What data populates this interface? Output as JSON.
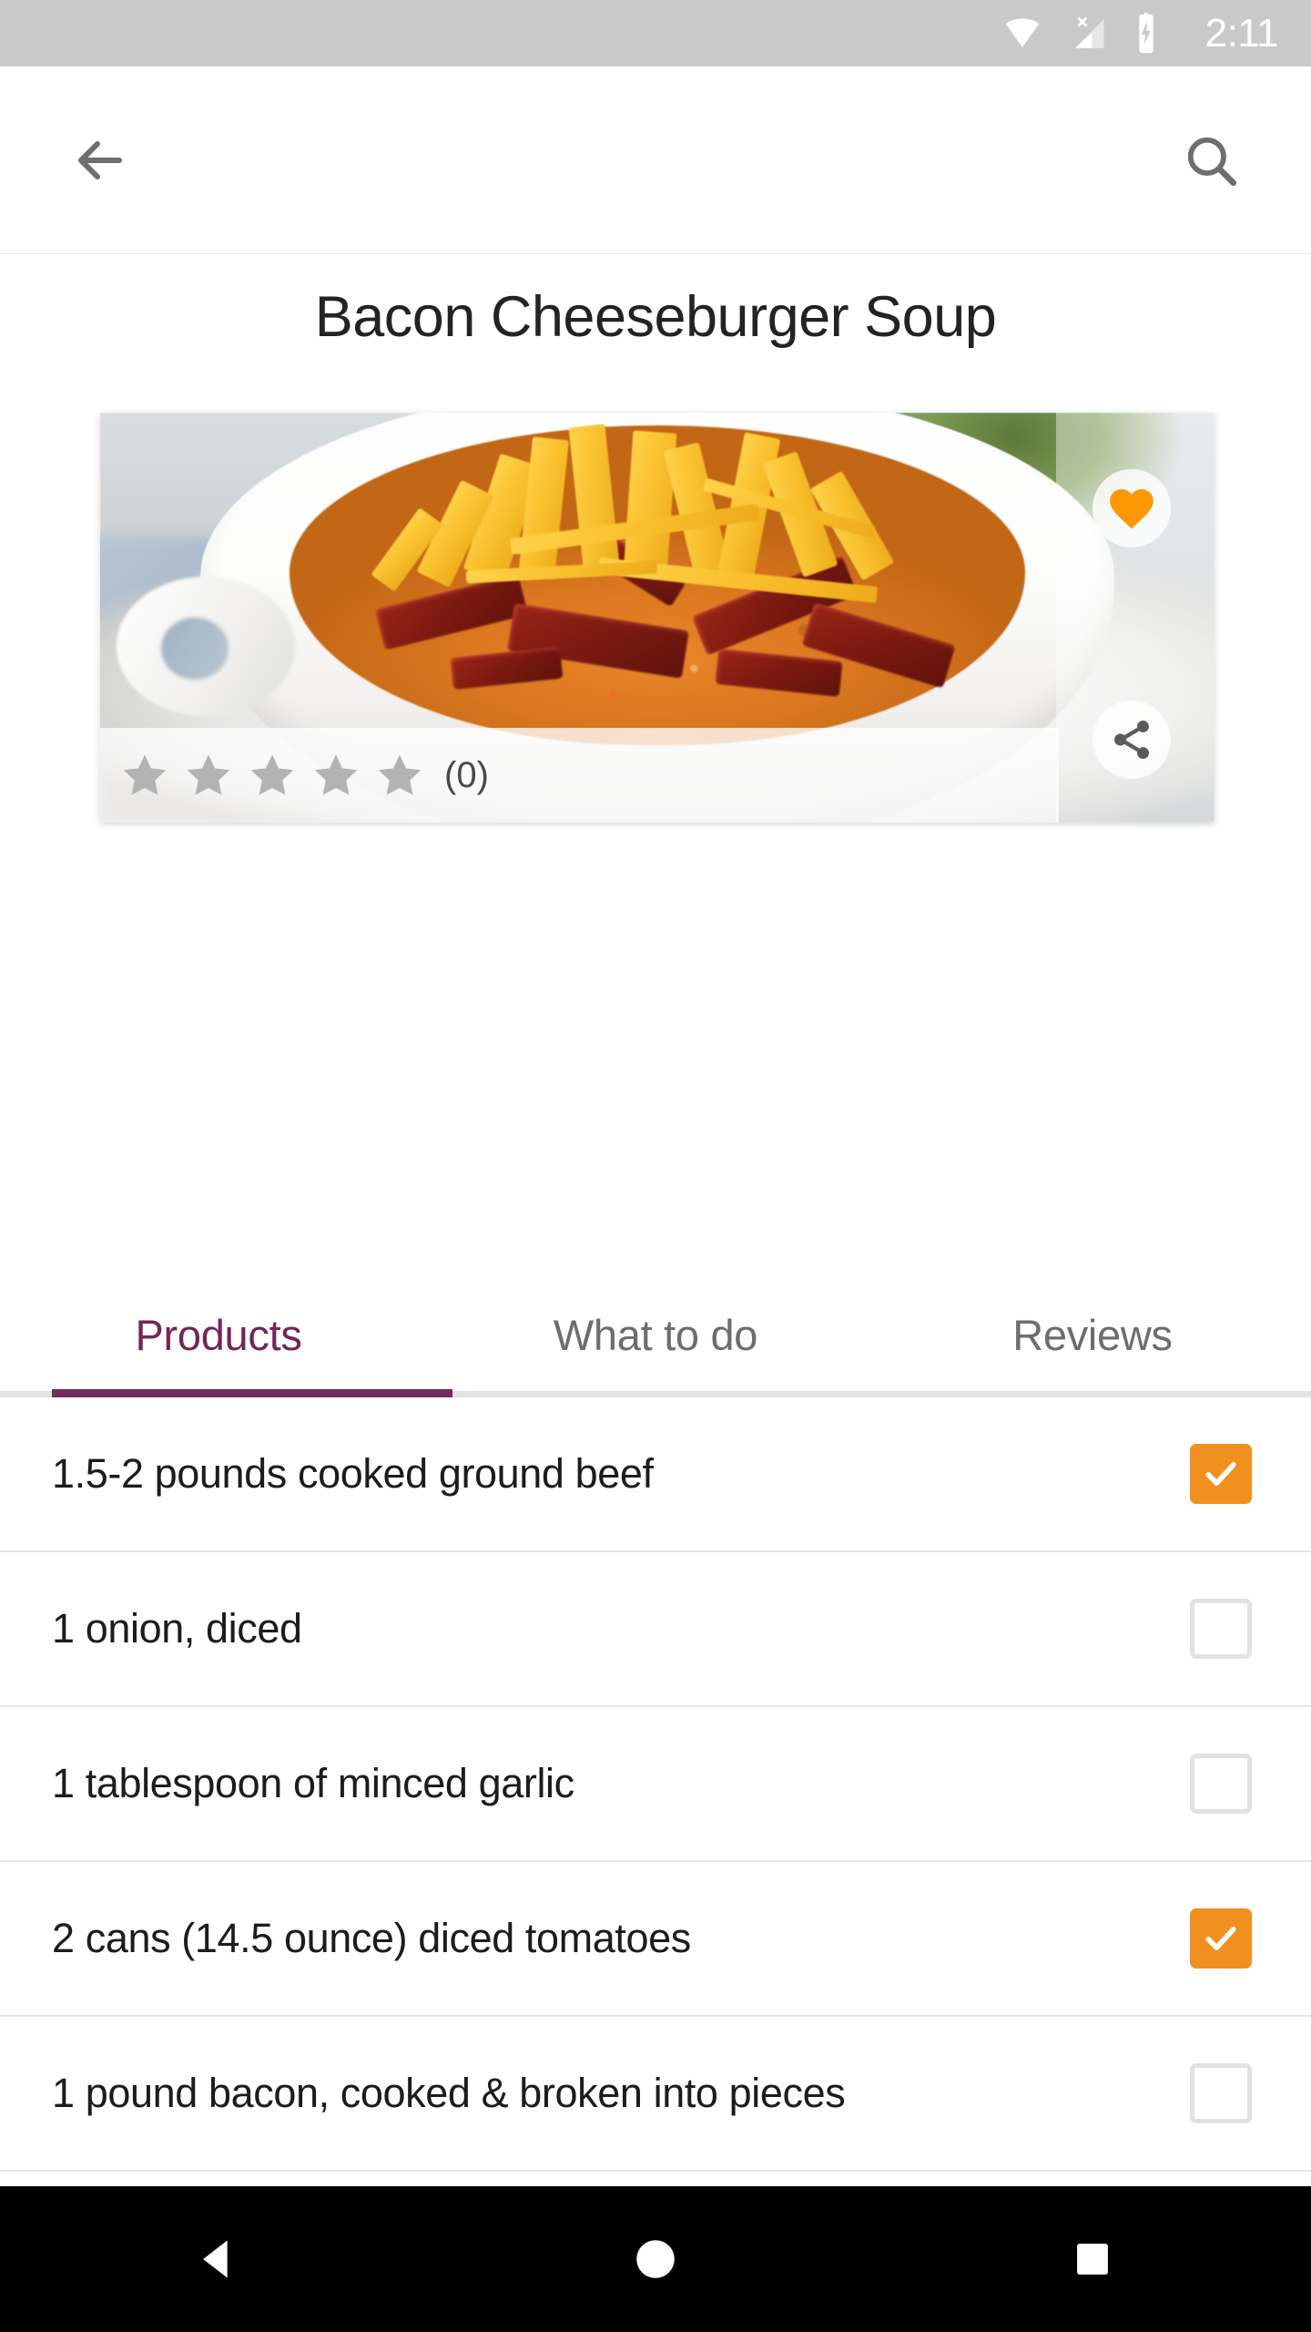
{
  "status_bar": {
    "time": "2:11",
    "icons": [
      "wifi-icon",
      "cellular-no-sim-icon",
      "battery-charging-icon"
    ],
    "background_color": "#c9c9c9",
    "foreground_color": "#ffffff"
  },
  "app_bar": {
    "back_label": "Back",
    "back_icon": "arrow-back-icon",
    "search_label": "Search",
    "search_icon": "search-icon",
    "icon_color": "#6e6e6e"
  },
  "recipe": {
    "title": "Bacon Cheeseburger Soup",
    "image_alt": "bowl of bacon cheeseburger soup topped with shredded cheddar cheese and bacon pieces",
    "favorite": {
      "icon": "heart-icon",
      "label": "Favorite",
      "active": true,
      "color": "#FF9800"
    },
    "share": {
      "icon": "share-icon",
      "label": "Share",
      "color": "#5a5a5a"
    },
    "rating": {
      "stars_total": 5,
      "stars_filled": 0,
      "star_color": "#b3b3b3",
      "count_label": "(0)",
      "count": 0
    }
  },
  "tabs": {
    "active_index": 0,
    "active_color": "#722659",
    "inactive_color": "#6d6d6d",
    "items": [
      {
        "label": "Products"
      },
      {
        "label": "What to do"
      },
      {
        "label": "Reviews"
      }
    ]
  },
  "ingredients": {
    "checked_color": "#f0901e",
    "unchecked_border_color": "#e2e2e2",
    "items": [
      {
        "label": "1.5-2 pounds cooked ground beef",
        "checked": true
      },
      {
        "label": "1 onion, diced",
        "checked": false
      },
      {
        "label": "1 tablespoon of minced garlic",
        "checked": false
      },
      {
        "label": "2 cans (14.5 ounce) diced tomatoes",
        "checked": true
      },
      {
        "label": "1 pound bacon, cooked & broken into pieces",
        "checked": false
      }
    ]
  },
  "nav_bar": {
    "background_color": "#000000",
    "buttons": [
      {
        "name": "back",
        "icon": "triangle-back-icon"
      },
      {
        "name": "home",
        "icon": "circle-home-icon"
      },
      {
        "name": "recents",
        "icon": "square-recents-icon"
      }
    ]
  }
}
